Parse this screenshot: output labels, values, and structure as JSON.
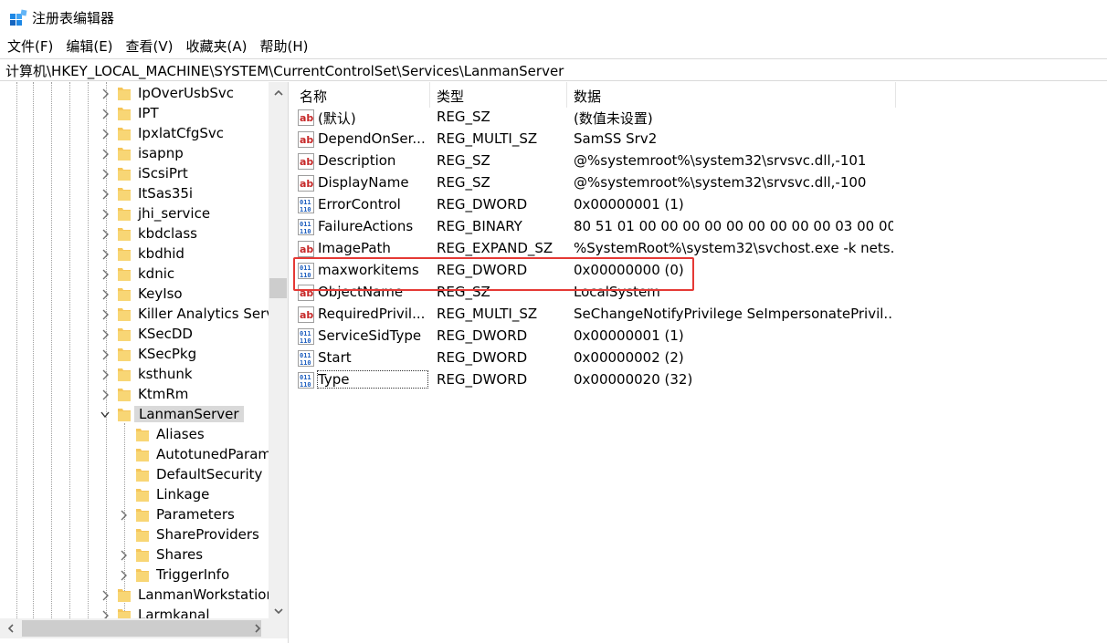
{
  "window": {
    "title": "注册表编辑器"
  },
  "menu": [
    "文件(F)",
    "编辑(E)",
    "查看(V)",
    "收藏夹(A)",
    "帮助(H)"
  ],
  "address": "计算机\\HKEY_LOCAL_MACHINE\\SYSTEM\\CurrentControlSet\\Services\\LanmanServer",
  "tree": {
    "items": [
      {
        "label": "IpOverUsbSvc",
        "level": 0,
        "expandable": true
      },
      {
        "label": "IPT",
        "level": 0,
        "expandable": true
      },
      {
        "label": "IpxlatCfgSvc",
        "level": 0,
        "expandable": true
      },
      {
        "label": "isapnp",
        "level": 0,
        "expandable": true
      },
      {
        "label": "iScsiPrt",
        "level": 0,
        "expandable": true
      },
      {
        "label": "ItSas35i",
        "level": 0,
        "expandable": true
      },
      {
        "label": "jhi_service",
        "level": 0,
        "expandable": true
      },
      {
        "label": "kbdclass",
        "level": 0,
        "expandable": true
      },
      {
        "label": "kbdhid",
        "level": 0,
        "expandable": true
      },
      {
        "label": "kdnic",
        "level": 0,
        "expandable": true
      },
      {
        "label": "KeyIso",
        "level": 0,
        "expandable": true
      },
      {
        "label": "Killer Analytics Serv",
        "level": 0,
        "expandable": true
      },
      {
        "label": "KSecDD",
        "level": 0,
        "expandable": true
      },
      {
        "label": "KSecPkg",
        "level": 0,
        "expandable": true
      },
      {
        "label": "ksthunk",
        "level": 0,
        "expandable": true
      },
      {
        "label": "KtmRm",
        "level": 0,
        "expandable": true
      },
      {
        "label": "LanmanServer",
        "level": 0,
        "expandable": true,
        "expanded": true,
        "selected": true
      },
      {
        "label": "Aliases",
        "level": 1,
        "expandable": false
      },
      {
        "label": "AutotunedParam",
        "level": 1,
        "expandable": false
      },
      {
        "label": "DefaultSecurity",
        "level": 1,
        "expandable": false
      },
      {
        "label": "Linkage",
        "level": 1,
        "expandable": false
      },
      {
        "label": "Parameters",
        "level": 1,
        "expandable": true
      },
      {
        "label": "ShareProviders",
        "level": 1,
        "expandable": false
      },
      {
        "label": "Shares",
        "level": 1,
        "expandable": true
      },
      {
        "label": "TriggerInfo",
        "level": 1,
        "expandable": true
      },
      {
        "label": "LanmanWorkstation",
        "level": 0,
        "expandable": true
      },
      {
        "label": "Larmkanal",
        "level": 0,
        "expandable": true
      }
    ]
  },
  "list": {
    "headers": {
      "name": "名称",
      "type": "类型",
      "data": "数据"
    },
    "rows": [
      {
        "icon": "string-value-icon",
        "name": "(默认)",
        "type": "REG_SZ",
        "data": "(数值未设置)"
      },
      {
        "icon": "string-value-icon",
        "name": "DependOnSer...",
        "type": "REG_MULTI_SZ",
        "data": "SamSS Srv2"
      },
      {
        "icon": "string-value-icon",
        "name": "Description",
        "type": "REG_SZ",
        "data": "@%systemroot%\\system32\\srvsvc.dll,-101"
      },
      {
        "icon": "string-value-icon",
        "name": "DisplayName",
        "type": "REG_SZ",
        "data": "@%systemroot%\\system32\\srvsvc.dll,-100"
      },
      {
        "icon": "binary-value-icon",
        "name": "ErrorControl",
        "type": "REG_DWORD",
        "data": "0x00000001 (1)"
      },
      {
        "icon": "binary-value-icon",
        "name": "FailureActions",
        "type": "REG_BINARY",
        "data": "80 51 01 00 00 00 00 00 00 00 00 00 03 00 00 ..."
      },
      {
        "icon": "string-value-icon",
        "name": "ImagePath",
        "type": "REG_EXPAND_SZ",
        "data": "%SystemRoot%\\system32\\svchost.exe -k nets..."
      },
      {
        "icon": "binary-value-icon",
        "name": "maxworkitems",
        "type": "REG_DWORD",
        "data": "0x00000000 (0)"
      },
      {
        "icon": "string-value-icon",
        "name": "ObjectName",
        "type": "REG_SZ",
        "data": "LocalSystem"
      },
      {
        "icon": "string-value-icon",
        "name": "RequiredPrivil...",
        "type": "REG_MULTI_SZ",
        "data": "SeChangeNotifyPrivilege SeImpersonatePrivil..."
      },
      {
        "icon": "binary-value-icon",
        "name": "ServiceSidType",
        "type": "REG_DWORD",
        "data": "0x00000001 (1)"
      },
      {
        "icon": "binary-value-icon",
        "name": "Start",
        "type": "REG_DWORD",
        "data": "0x00000002 (2)"
      },
      {
        "icon": "binary-value-icon",
        "name": "Type",
        "type": "REG_DWORD",
        "data": "0x00000020 (32)"
      }
    ]
  },
  "colors": {
    "highlight": "#e53935",
    "folder": "#f5c65a",
    "selection": "#d9d9d9",
    "dword_icon": "#1f5fbf",
    "string_icon": "#c62828"
  }
}
